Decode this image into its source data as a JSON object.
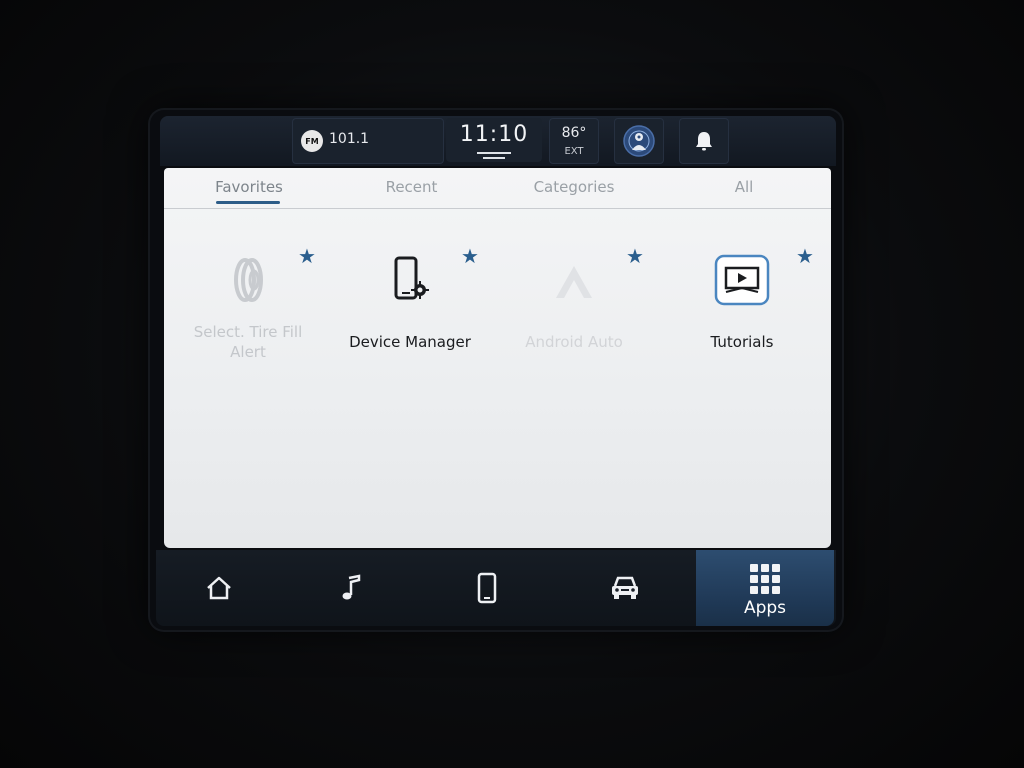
{
  "status_bar": {
    "radio_band": "FM",
    "radio_station": "101.1",
    "clock": "11:10",
    "temperature": "86°",
    "temperature_label": "EXT"
  },
  "tabs": [
    {
      "label": "Favorites",
      "active": true
    },
    {
      "label": "Recent",
      "active": false
    },
    {
      "label": "Categories",
      "active": false
    },
    {
      "label": "All",
      "active": false
    }
  ],
  "apps": [
    {
      "label_line1": "Select. Tire Fill",
      "label_line2": "Alert",
      "icon": "tire-icon",
      "enabled": false,
      "favorite": true
    },
    {
      "label_line1": "Device Manager",
      "label_line2": "",
      "icon": "phone-settings-icon",
      "enabled": true,
      "favorite": true
    },
    {
      "label_line1": "Android Auto",
      "label_line2": "",
      "icon": "android-auto-icon",
      "enabled": false,
      "favorite": true
    },
    {
      "label_line1": "Tutorials",
      "label_line2": "",
      "icon": "tutorials-icon",
      "enabled": true,
      "favorite": true
    }
  ],
  "bottom_nav": {
    "items": [
      {
        "icon": "home-icon"
      },
      {
        "icon": "music-note-icon"
      },
      {
        "icon": "phone-icon"
      },
      {
        "icon": "car-icon"
      }
    ],
    "apps_label": "Apps"
  },
  "colors": {
    "accent": "#2b5f8e",
    "apps_active_bg": "#1f3855",
    "disabled_text": "#c4c7cb",
    "enabled_text": "#1a1c1f"
  }
}
